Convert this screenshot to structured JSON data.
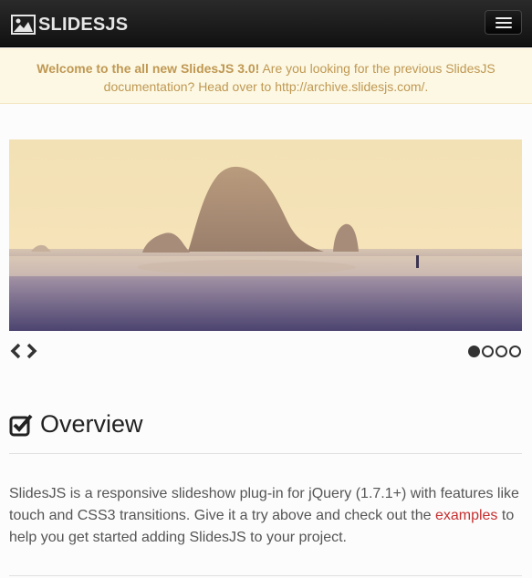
{
  "navbar": {
    "brand": "SLIDESJS",
    "brand_icon": "picture-icon",
    "menu_icon": "hamburger-menu-icon"
  },
  "alert": {
    "strong": "Welcome to the all new SlidesJS 3.0!",
    "text": " Are you looking for the previous SlidesJS documentation? Head over to ",
    "link": "http://archive.slidesjs.com/",
    "end": "."
  },
  "slideshow": {
    "prev_icon": "chevron-left-icon",
    "next_icon": "chevron-right-icon",
    "slide_count": 4,
    "active_slide": 1
  },
  "overview": {
    "icon": "check-square-icon",
    "title": "Overview",
    "text_before": "SlidesJS is a responsive slideshow plug-in for jQuery (1.7.1+) with features like touch and CSS3 transitions. Give it a try above and check out the ",
    "link": "examples",
    "text_after": " to help you get started adding SlidesJS to your project."
  },
  "colors": {
    "navbar": "#1a1a1a",
    "alert_bg": "#fcf8e3",
    "alert_text": "#c09853",
    "link": "#c62f2f"
  }
}
